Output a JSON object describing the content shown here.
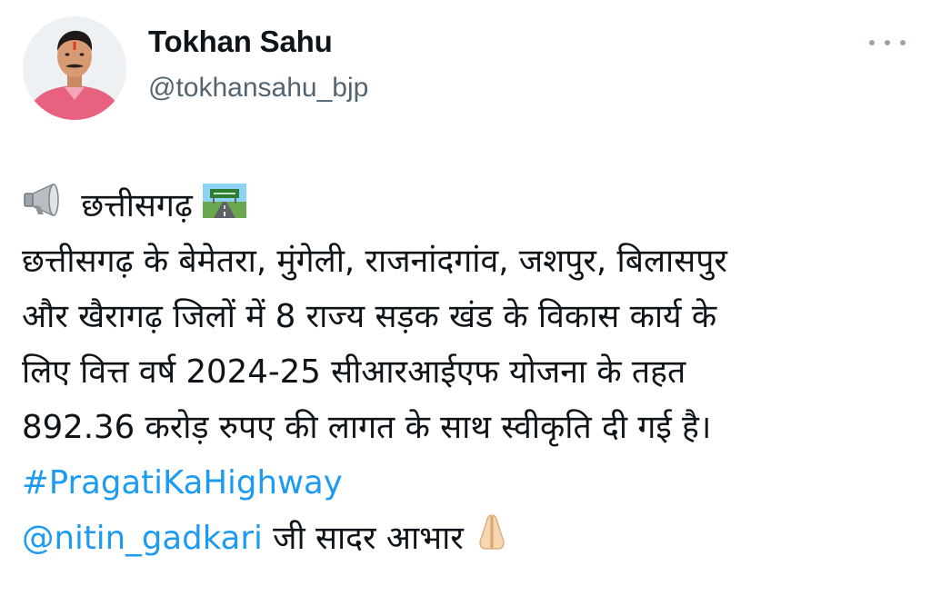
{
  "profile": {
    "name": "Tokhan Sahu",
    "handle": "@tokhansahu_bjp"
  },
  "tweet": {
    "emoji_megaphone": "megaphone-icon",
    "line1": "छत्तीसगढ़",
    "emoji_road": "motorway-icon",
    "line2": "छत्तीसगढ़ के बेमेतरा, मुंगेली, राजनांदगांव, जशपुर, बिलासपुर",
    "line3": "और खैरागढ़ जिलों में 8 राज्य सड़क खंड के विकास कार्य के",
    "line4": "लिए वित्त वर्ष 2024-25 सीआरआईएफ योजना के तहत",
    "line5": "892.36 करोड़ रुपए की लागत के साथ स्वीकृति दी गई है।",
    "hashtag": "#PragatiKaHighway",
    "mention": "@nitin_gadkari",
    "line7_rest": " जी सादर आभार ",
    "emoji_pray": "folded-hands-icon"
  },
  "colors": {
    "link": "#1d9bf0",
    "handle": "#536471",
    "text": "#0f1419"
  }
}
